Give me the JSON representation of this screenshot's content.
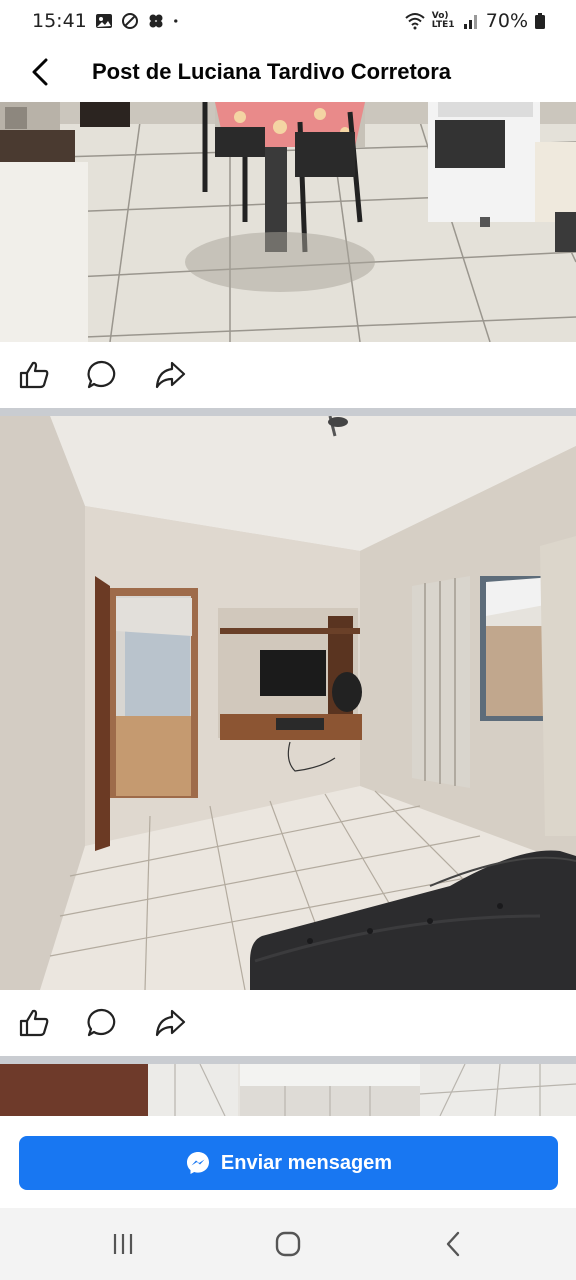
{
  "status_bar": {
    "time": "15:41",
    "left_icons": [
      "gallery-icon",
      "do-not-disturb-icon",
      "clover-icon",
      "dot-icon"
    ],
    "right_icons": [
      "wifi-icon",
      "volte-icon",
      "signal-icon",
      "battery-icon"
    ],
    "network_label": "Vo) LTE1",
    "battery": "70%"
  },
  "header": {
    "title": "Post de Luciana Tardivo Corretora",
    "back_icon": "back-arrow-icon"
  },
  "photos": [
    {
      "name": "kitchen-photo",
      "description_icon": "photo"
    },
    {
      "name": "living-room-photo",
      "description_icon": "photo"
    },
    {
      "name": "bathroom-photo",
      "description_icon": "photo"
    }
  ],
  "actions": [
    {
      "name": "like-button",
      "icon": "thumbs-up-icon"
    },
    {
      "name": "comment-button",
      "icon": "comment-icon"
    },
    {
      "name": "share-button",
      "icon": "share-icon"
    }
  ],
  "message_button": {
    "label": "Enviar mensagem",
    "icon": "messenger-icon",
    "color": "#1877f2"
  },
  "nav_bar": {
    "buttons": [
      "recent-apps-icon",
      "home-icon",
      "back-icon"
    ]
  }
}
